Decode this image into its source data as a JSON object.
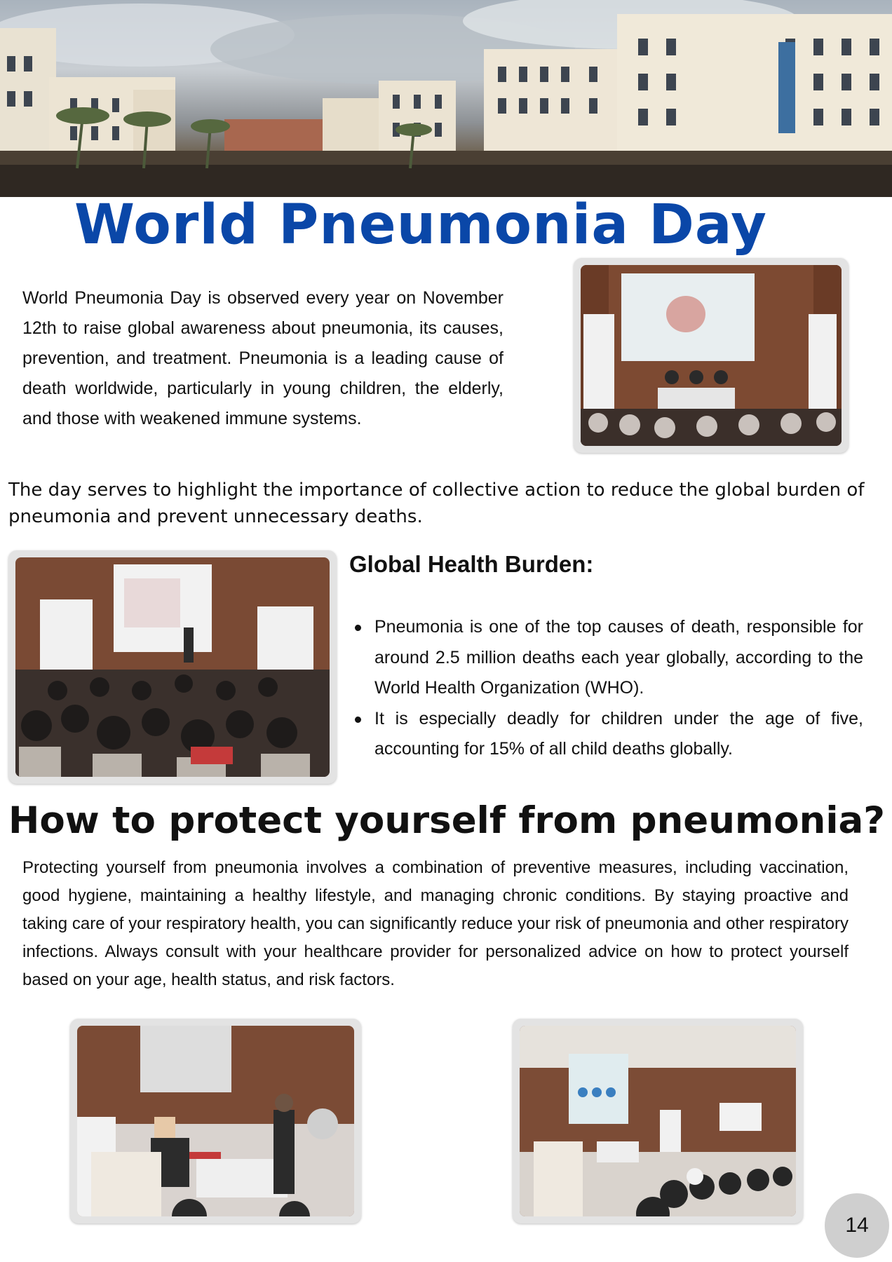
{
  "page": {
    "title": "World Pneumonia Day",
    "intro": "World Pneumonia Day is observed every year on November 12th to raise global awareness about pneumonia, its causes, prevention, and treatment. Pneumonia is a leading cause of death worldwide, particularly in young children, the elderly, and those with weakened immune systems.",
    "serves": " The day serves to highlight the importance of collective action to reduce the global burden of pneumonia and prevent unnecessary deaths.",
    "page_number": "14"
  },
  "burden": {
    "heading": "Global Health Burden:",
    "items": [
      "Pneumonia is one of the top causes of death, responsible for around 2.5 million deaths each year globally, according to the World Health Organization (WHO).",
      "It is especially deadly for children under the age of five, accounting for 15% of all child deaths globally."
    ]
  },
  "protect": {
    "heading": "How to protect yourself from pneumonia?",
    "text": "Protecting yourself from pneumonia involves a combination of preventive measures, including vaccination, good hygiene, maintaining a healthy lifestyle, and managing chronic conditions. By staying proactive and taking care of your respiratory health, you can significantly reduce your risk of pneumonia and other respiratory infections. Always consult with your healthcare provider for personalized advice on how to protect yourself based on your age, health status, and risk factors."
  },
  "colors": {
    "title_blue": "#0a47a8",
    "photo_frame": "#e3e3e3",
    "page_badge": "#cfcfcf"
  }
}
